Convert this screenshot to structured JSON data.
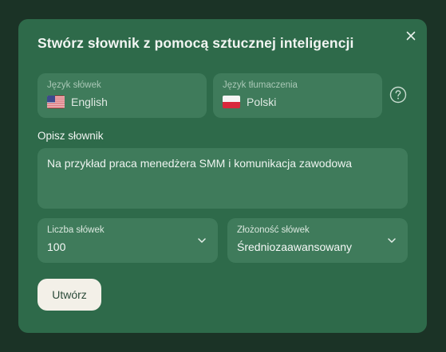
{
  "dialog": {
    "title": "Stwórz słownik z pomocą sztucznej inteligencji",
    "close_icon": "close-icon"
  },
  "languages": {
    "word_language": {
      "label": "Język słówek",
      "value": "English",
      "flag": "us-flag-icon"
    },
    "translation_language": {
      "label": "Język tłumaczenia",
      "value": "Polski",
      "flag": "pl-flag-icon"
    },
    "help_icon": "help-icon"
  },
  "description": {
    "label": "Opisz słownik",
    "placeholder": "Na przykład praca menedżera SMM i komunikacja zawodowa"
  },
  "options": {
    "word_count": {
      "label": "Liczba słówek",
      "value": "100"
    },
    "complexity": {
      "label": "Złożoność słówek",
      "value": "Średniozaawansowany"
    }
  },
  "actions": {
    "create_label": "Utwórz"
  },
  "colors": {
    "backdrop": "#1b3326",
    "modal": "#2e6a4a",
    "field": "#3f7b5b",
    "button": "#f3f0e8"
  }
}
